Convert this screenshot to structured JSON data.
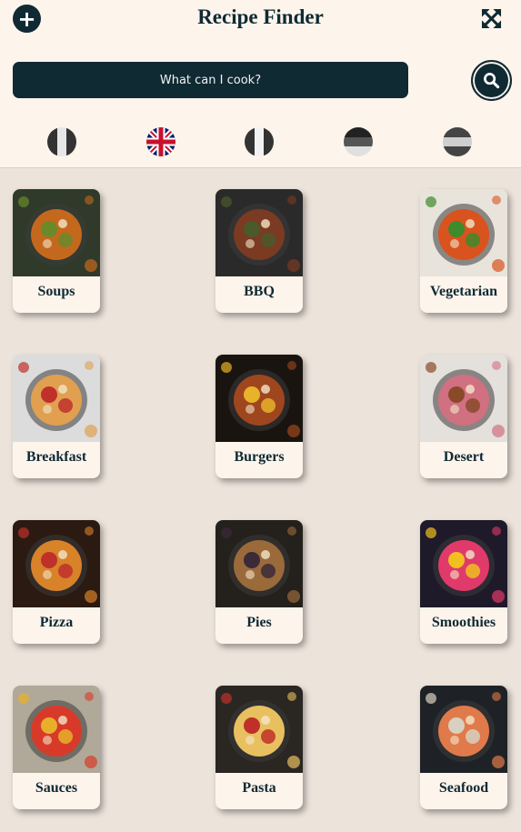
{
  "header": {
    "title": "Recipe Finder",
    "add_icon": "plus-icon",
    "expand_icon": "expand-arrows-icon"
  },
  "search": {
    "placeholder": "What can I cook?",
    "button_icon": "search-icon"
  },
  "languages": [
    {
      "name": "italian-flag-icon",
      "colors": [
        "#333333",
        "#e6e6e6",
        "#333333"
      ],
      "orientation": "vertical"
    },
    {
      "name": "uk-flag-icon",
      "colors": [
        "#012169",
        "#ffffff",
        "#c8102e"
      ],
      "orientation": "union-jack"
    },
    {
      "name": "french-flag-icon",
      "colors": [
        "#333333",
        "#f2f2f2",
        "#333333"
      ],
      "orientation": "vertical"
    },
    {
      "name": "german-flag-icon",
      "colors": [
        "#222222",
        "#555555",
        "#e0e0e0"
      ],
      "orientation": "horizontal"
    },
    {
      "name": "spanish-flag-icon",
      "colors": [
        "#444444",
        "#cfcfcf",
        "#444444"
      ],
      "orientation": "horizontal"
    }
  ],
  "categories": [
    {
      "label": "Soups",
      "image": "soup-bowl-photo",
      "colors": [
        "#2f3a2a",
        "#c4681e",
        "#6a8a2a"
      ]
    },
    {
      "label": "BBQ",
      "image": "grilled-meat-photo",
      "colors": [
        "#2a2a2a",
        "#7a3b22",
        "#4a5a2a"
      ]
    },
    {
      "label": "Vegetarian",
      "image": "vegetable-bowl-photo",
      "colors": [
        "#e8e4dc",
        "#d9531e",
        "#3f8a2a"
      ]
    },
    {
      "label": "Breakfast",
      "image": "breakfast-spread-photo",
      "colors": [
        "#dcdcdc",
        "#e0a050",
        "#c0302a"
      ]
    },
    {
      "label": "Burgers",
      "image": "burger-photo",
      "colors": [
        "#1a1410",
        "#a0461e",
        "#e8b22a"
      ]
    },
    {
      "label": "Desert",
      "image": "dessert-spread-photo",
      "colors": [
        "#e4e0dc",
        "#d07080",
        "#8a4a2a"
      ]
    },
    {
      "label": "Pizza",
      "image": "pizza-photo",
      "colors": [
        "#2a1a12",
        "#d8822a",
        "#c0302a"
      ]
    },
    {
      "label": "Pies",
      "image": "pie-photo",
      "colors": [
        "#24201c",
        "#9a6a3a",
        "#3a2a3a"
      ]
    },
    {
      "label": "Smoothies",
      "image": "smoothie-photo",
      "colors": [
        "#1e1a2a",
        "#e03a6a",
        "#f0c020"
      ]
    },
    {
      "label": "Sauces",
      "image": "sauce-bowls-photo",
      "colors": [
        "#b0a898",
        "#d83a2a",
        "#e8b02a"
      ]
    },
    {
      "label": "Pasta",
      "image": "pasta-plate-photo",
      "colors": [
        "#2a2622",
        "#e8c060",
        "#c0302a"
      ]
    },
    {
      "label": "Seafood",
      "image": "seafood-platter-photo",
      "colors": [
        "#1e2226",
        "#e07a4a",
        "#d8d0c0"
      ]
    }
  ]
}
